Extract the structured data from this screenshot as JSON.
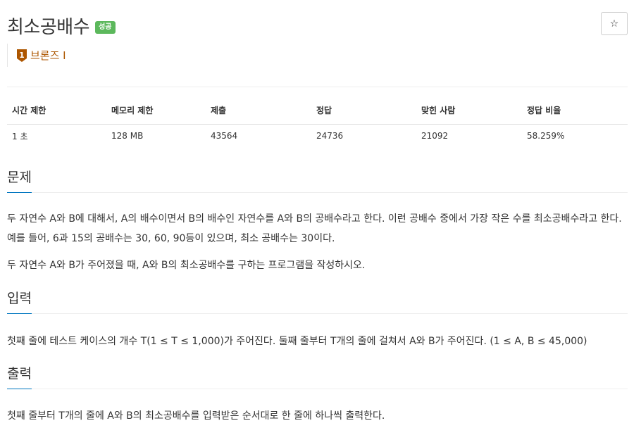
{
  "problem": {
    "title": "최소공배수",
    "status_badge": "성공",
    "star_icon": "☆",
    "tier_label": "브론즈 I",
    "tier_number": "1",
    "tier_color": "#ad5600"
  },
  "info_table": {
    "headers": [
      "시간 제한",
      "메모리 제한",
      "제출",
      "정답",
      "맞힌 사람",
      "정답 비율"
    ],
    "values": [
      "1 초",
      "128 MB",
      "43564",
      "24736",
      "21092",
      "58.259%"
    ]
  },
  "sections": {
    "description": {
      "heading": "문제",
      "paragraphs": [
        "두 자연수 A와 B에 대해서, A의 배수이면서 B의 배수인 자연수를 A와 B의 공배수라고 한다. 이런 공배수 중에서 가장 작은 수를 최소공배수라고 한다. 예를 들어, 6과 15의 공배수는 30, 60, 90등이 있으며, 최소 공배수는 30이다.",
        "두 자연수 A와 B가 주어졌을 때, A와 B의 최소공배수를 구하는 프로그램을 작성하시오."
      ]
    },
    "input": {
      "heading": "입력",
      "paragraph": "첫째 줄에 테스트 케이스의 개수 T(1 ≤ T ≤ 1,000)가 주어진다. 둘째 줄부터 T개의 줄에 걸쳐서 A와 B가 주어진다. (1 ≤ A, B ≤ 45,000)"
    },
    "output": {
      "heading": "출력",
      "paragraph": "첫째 줄부터 T개의 줄에 A와 B의 최소공배수를 입력받은 순서대로 한 줄에 하나씩 출력한다."
    }
  },
  "colors": {
    "success": "#5cb85c",
    "accent_underline": "#0076c0",
    "bronze": "#ad5600"
  }
}
